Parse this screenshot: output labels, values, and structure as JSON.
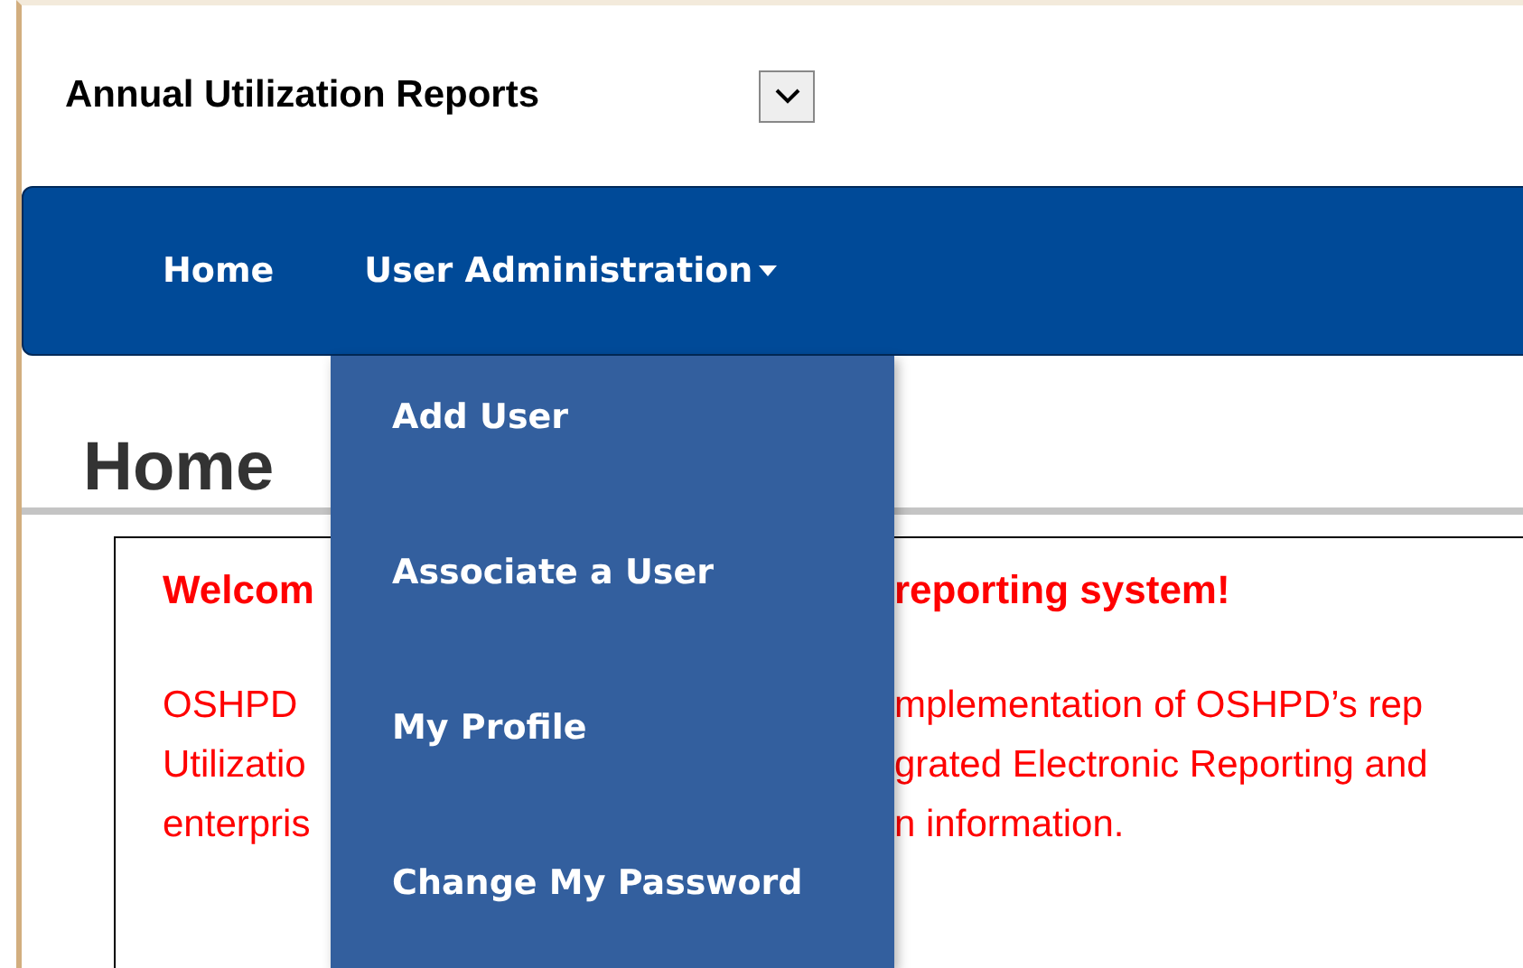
{
  "report_select": {
    "label": "Annual Utilization Reports"
  },
  "nav": {
    "items": [
      {
        "label": "Home",
        "kind": "link"
      },
      {
        "label": "User Administration",
        "kind": "dropdown"
      }
    ]
  },
  "dropdown": {
    "items": [
      {
        "label": "Add User"
      },
      {
        "label": "Associate a User"
      },
      {
        "label": "My Profile"
      },
      {
        "label": "Change My Password"
      }
    ]
  },
  "page_title": "Home",
  "content": {
    "heading": {
      "left": "Welcom",
      "right": "reporting system!"
    },
    "lines": [
      {
        "left": "OSHPD",
        "right": "mplementation of OSHPD’s rep"
      },
      {
        "left": "Utilizatio",
        "right": "grated Electronic Reporting and"
      },
      {
        "left": "enterpris",
        "right": "n information."
      }
    ]
  }
}
